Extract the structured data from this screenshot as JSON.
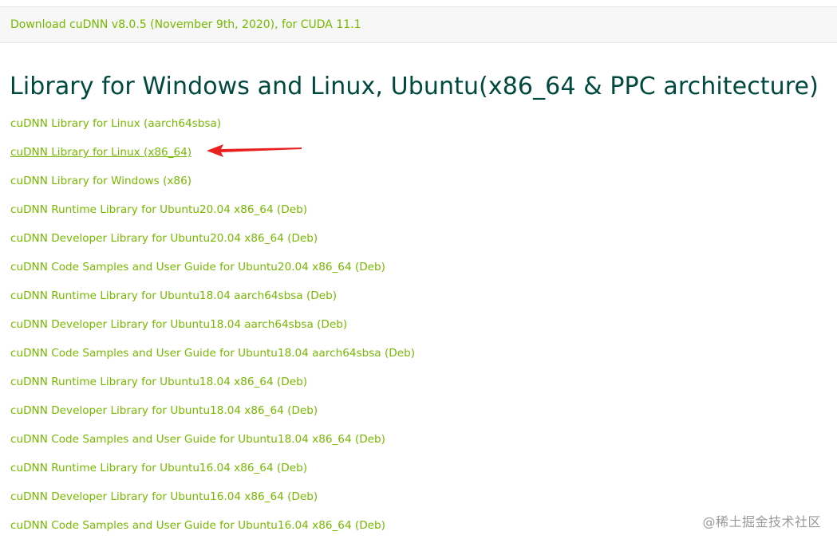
{
  "accordion": {
    "header_link": "Download cuDNN v8.0.5 (November 9th, 2020), for CUDA 11.1"
  },
  "section": {
    "title": "Library for Windows and Linux, Ubuntu(x86_64 & PPC architecture)"
  },
  "downloads": [
    "cuDNN Library for Linux (aarch64sbsa)",
    "cuDNN Library for Linux (x86_64)",
    "cuDNN Library for Windows (x86)",
    "cuDNN Runtime Library for Ubuntu20.04 x86_64 (Deb)",
    "cuDNN Developer Library for Ubuntu20.04 x86_64 (Deb)",
    "cuDNN Code Samples and User Guide for Ubuntu20.04 x86_64 (Deb)",
    "cuDNN Runtime Library for Ubuntu18.04 aarch64sbsa (Deb)",
    "cuDNN Developer Library for Ubuntu18.04 aarch64sbsa (Deb)",
    "cuDNN Code Samples and User Guide for Ubuntu18.04 aarch64sbsa (Deb)",
    "cuDNN Runtime Library for Ubuntu18.04 x86_64 (Deb)",
    "cuDNN Developer Library for Ubuntu18.04 x86_64 (Deb)",
    "cuDNN Code Samples and User Guide for Ubuntu18.04 x86_64 (Deb)",
    "cuDNN Runtime Library for Ubuntu16.04 x86_64 (Deb)",
    "cuDNN Developer Library for Ubuntu16.04 x86_64 (Deb)",
    "cuDNN Code Samples and User Guide for Ubuntu16.04 x86_64 (Deb)"
  ],
  "watermark": "@稀土掘金技术社区",
  "annotation": {
    "icon": "arrow-left-icon",
    "color": "#e8211f"
  },
  "colors": {
    "link": "#76b900",
    "title": "#00493f",
    "header_bg": "#f7f7f7"
  }
}
